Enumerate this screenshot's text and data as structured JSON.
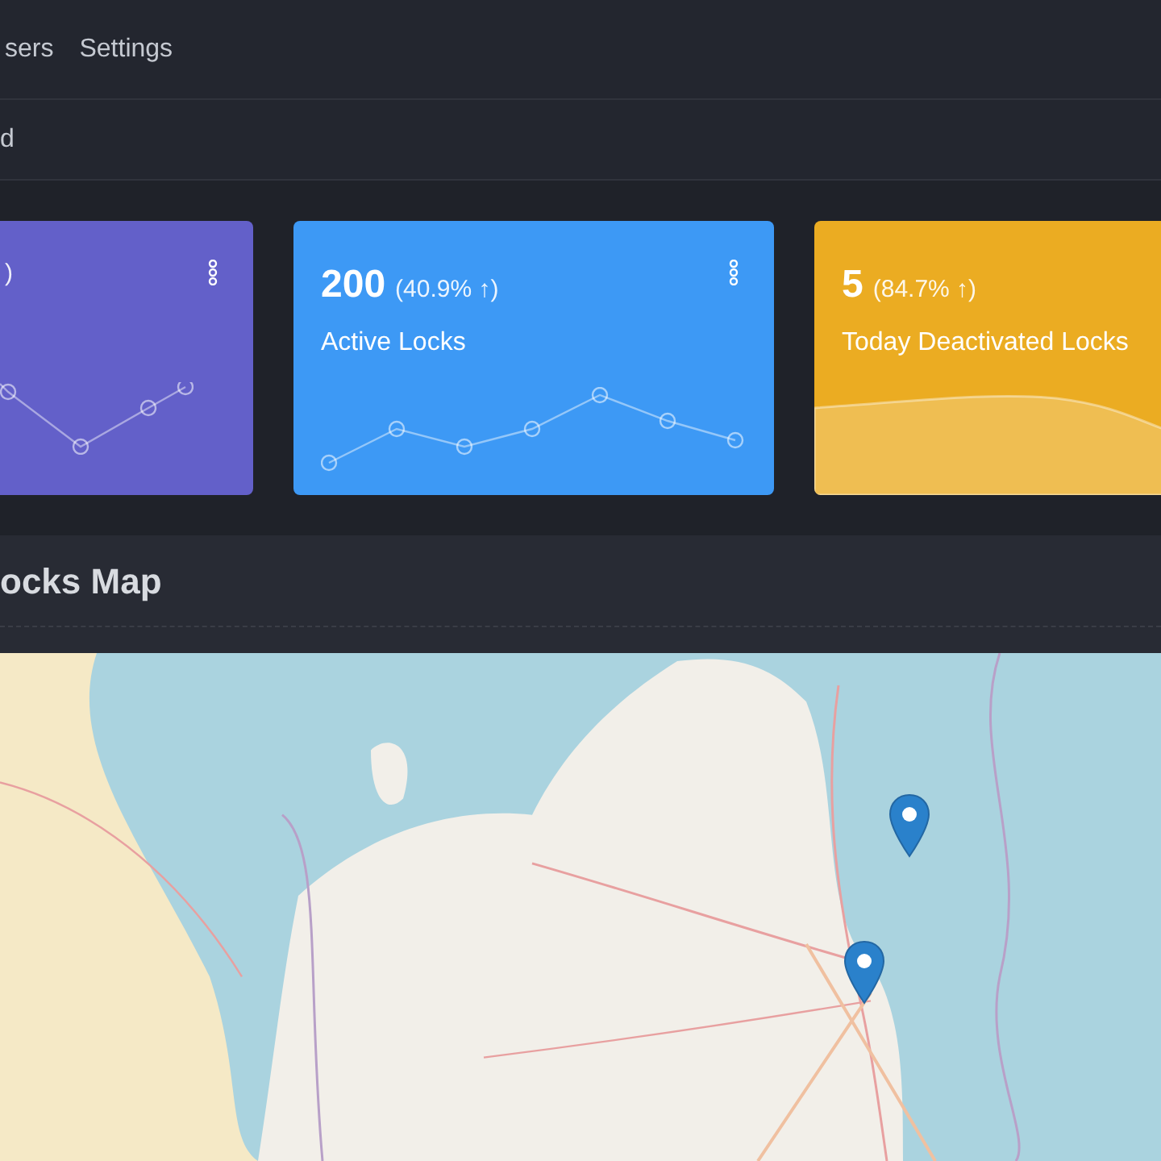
{
  "nav": {
    "items": [
      "sers",
      "Settings"
    ]
  },
  "breadcrumb": {
    "text": "d"
  },
  "cards": [
    {
      "kind": "line",
      "color": "#6360c9",
      "change": ")",
      "menu": true
    },
    {
      "kind": "line",
      "color": "#3d99f5",
      "value": "200",
      "change": "(40.9% ↑)",
      "label": "Active Locks",
      "menu": true
    },
    {
      "kind": "area",
      "color": "#ebac22",
      "value": "5",
      "change": "(84.7% ↑)",
      "label": "Today Deactivated Locks"
    }
  ],
  "map_section": {
    "title": "ocks Map"
  }
}
